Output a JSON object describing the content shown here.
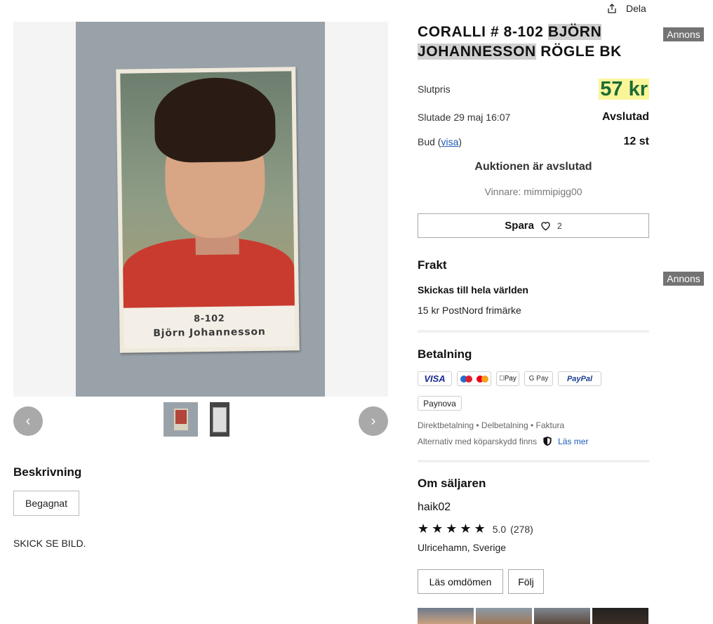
{
  "share": {
    "label": "Dela",
    "icon": "share-icon"
  },
  "gallery": {
    "card_number": "8-102",
    "card_name": "Björn Johannesson",
    "prev_icon": "chevron-left-icon",
    "next_icon": "chevron-right-icon",
    "prev_glyph": "‹",
    "next_glyph": "›"
  },
  "description": {
    "heading": "Beskrivning",
    "condition": "Begagnat",
    "text": "SKICK SE BILD."
  },
  "listing": {
    "title_part1": "CORALLI # 8-102 ",
    "title_highlight1": "BJÖRN",
    "title_highlight2": "JOHANNESSON",
    "title_part2": " RÖGLE BK",
    "ad_label_top": "Annons",
    "ad_label_mid": "Annons",
    "final_price_label": "Slutpris",
    "final_price": "57 kr",
    "ended_label": "Slutade 29 maj 16:07",
    "status": "Avslutad",
    "bids_label": "Bud",
    "bids_link": "visa",
    "bids_count": "12 st",
    "ended_message": "Auktionen är avslutad",
    "winner": "Vinnare: mimmipigg00",
    "save_label": "Spara",
    "save_count": "2"
  },
  "shipping": {
    "heading": "Frakt",
    "worldwide": "Skickas till hela världen",
    "option": "15 kr PostNord frimärke"
  },
  "payment": {
    "heading": "Betalning",
    "methods": {
      "visa": "VISA",
      "applepay": "Pay",
      "googlepay": "G Pay",
      "paypal": "PayPal",
      "paynova": "Paynova"
    },
    "types": "Direktbetalning • Delbetalning • Faktura",
    "protection": "Alternativ med köparskydd finns",
    "read_more": "Läs mer"
  },
  "seller": {
    "heading": "Om säljaren",
    "name": "haik02",
    "stars": "★★★★★",
    "score": "5.0",
    "reviews": "(278)",
    "location": "Ulricehamn, Sverige",
    "reviews_button": "Läs omdömen",
    "follow_button": "Följ"
  },
  "colors": {
    "price_text": "#1c6b35",
    "price_highlight": "#fbf59a",
    "link": "#1a5cb8",
    "ad_badge": "#737373"
  }
}
